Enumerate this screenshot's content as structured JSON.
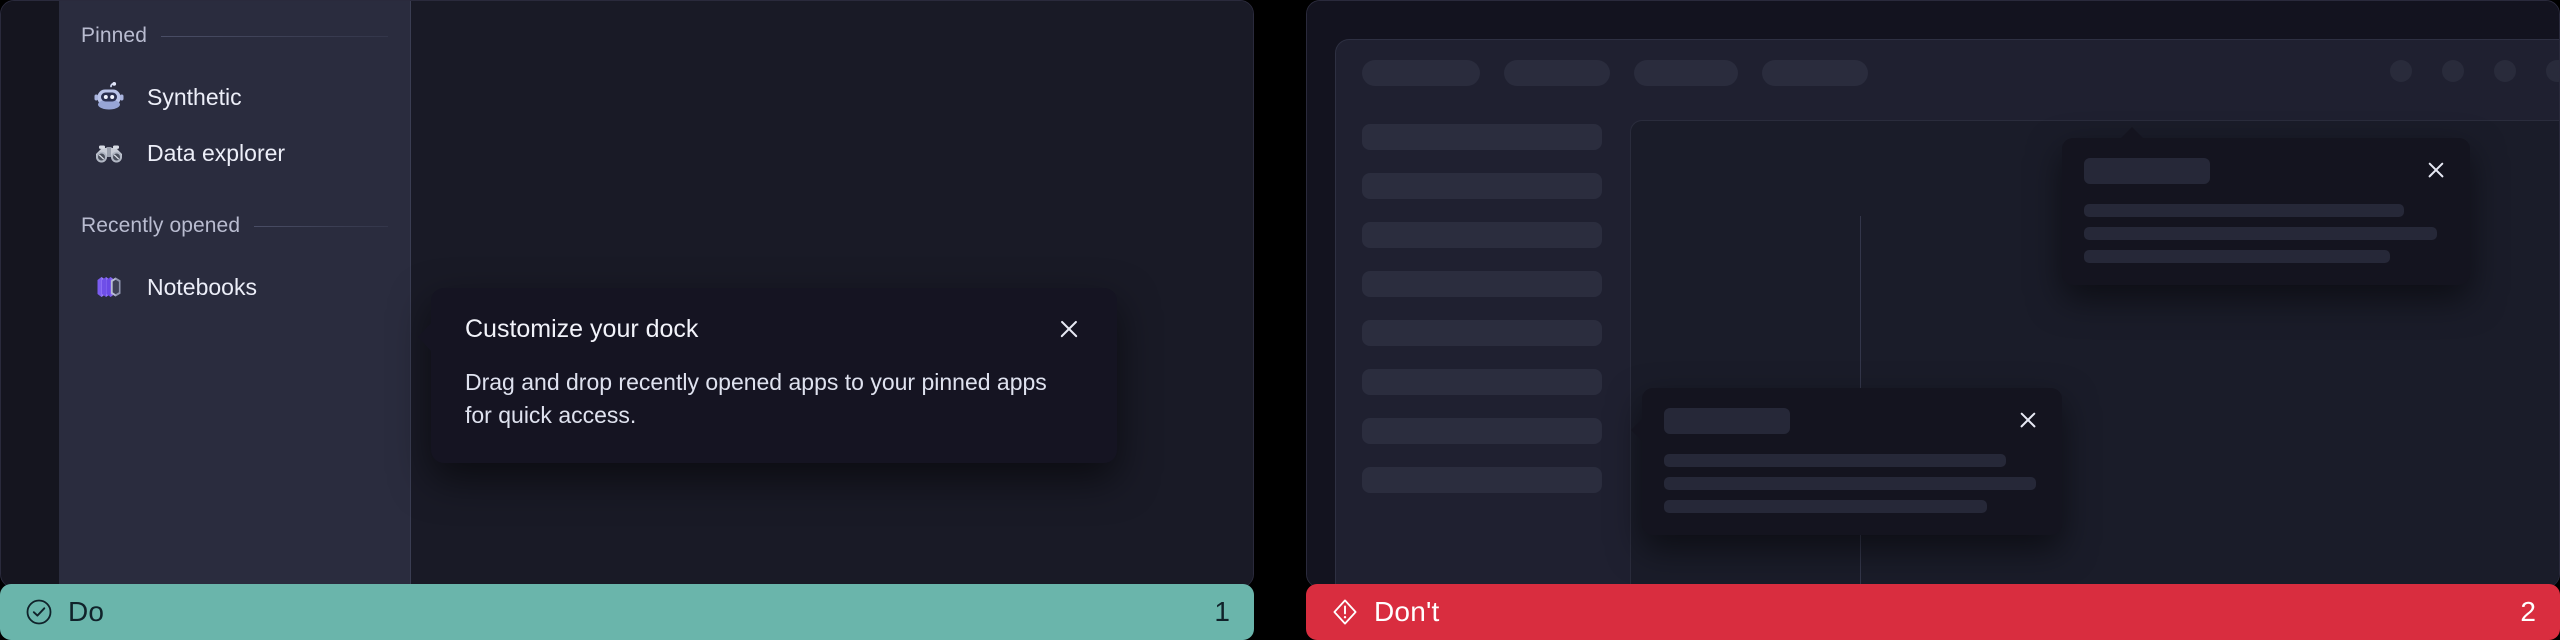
{
  "left_panel": {
    "name": "do-example",
    "sidebar": {
      "sections": [
        {
          "label": "Pinned",
          "items": [
            {
              "label": "Synthetic",
              "icon": "robot-icon"
            },
            {
              "label": "Data explorer",
              "icon": "binoculars-icon"
            }
          ]
        },
        {
          "label": "Recently opened",
          "items": [
            {
              "label": "Notebooks",
              "icon": "notebooks-icon"
            }
          ]
        }
      ]
    },
    "callout": {
      "title": "Customize your dock",
      "body": "Drag and drop recently opened apps to your pinned apps for quick access.",
      "close_icon": "close-icon"
    }
  },
  "right_panel": {
    "name": "dont-example",
    "topbar": {
      "pill_widths": [
        118,
        106,
        104,
        106
      ],
      "dots": 4
    },
    "list_rows": 8,
    "callouts": [
      {
        "close_icon": "close-icon",
        "line_widths": [
          "88%",
          "97%",
          "84%"
        ]
      },
      {
        "close_icon": "close-icon",
        "line_widths": [
          "91%",
          "99%",
          "86%"
        ]
      }
    ]
  },
  "banners": {
    "do": {
      "label": "Do",
      "count": "1",
      "icon": "check-circle-icon",
      "color": "#6ab5ab"
    },
    "dont": {
      "label": "Don't",
      "count": "2",
      "icon": "warning-diamond-icon",
      "color": "#d92d3f"
    }
  }
}
